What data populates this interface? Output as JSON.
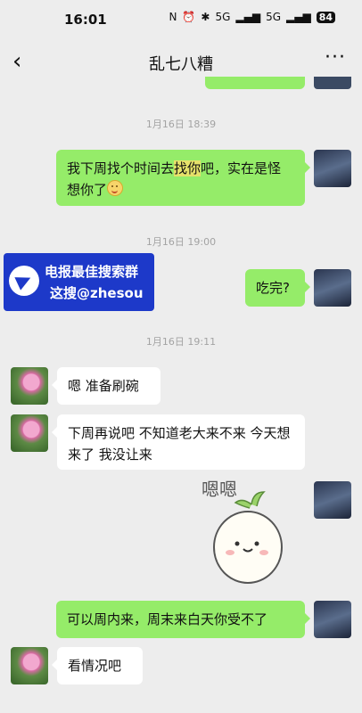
{
  "status": {
    "time": "16:01",
    "signal1": "5G",
    "signal2": "5G",
    "battery": "84"
  },
  "header": {
    "title": "乱七八糟"
  },
  "timestamps": [
    "1月16日 18:39",
    "1月16日 19:00",
    "1月16日 19:11"
  ],
  "messages": {
    "m1_a": "我下周找个时间去",
    "m1_hl": "找你",
    "m1_b": "吧，实在是怪想你了",
    "m2": "吃完?",
    "m3": "嗯 准备刷碗",
    "m4": "下周再说吧  不知道老大来不来  今天想来了 我没让来",
    "m5": "可以周内来，周末来白天你受不了",
    "m6": "看情况吧"
  },
  "sticker": {
    "text": "嗯嗯"
  },
  "promo": {
    "line1": "电报最佳搜索群",
    "line2": "这搜@zhesou"
  }
}
